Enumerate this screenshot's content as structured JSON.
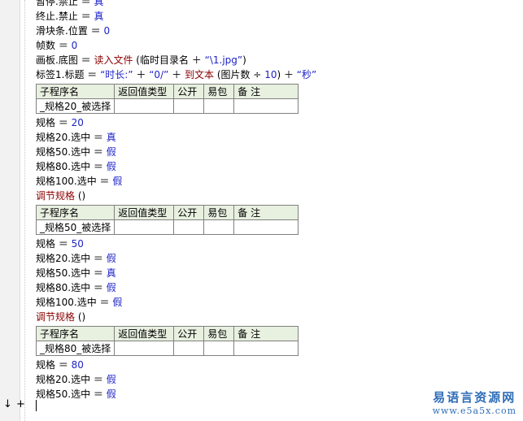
{
  "lines_top": [
    {
      "a": "暂停.禁止 ＝ ",
      "b": "真"
    },
    {
      "a": "终止.禁止 ＝ ",
      "b": "真"
    },
    {
      "a": "滑块条.位置 ＝ ",
      "b": "0"
    },
    {
      "a": "帧数 ＝ ",
      "b": "0"
    },
    {
      "a": "画板.底图 ＝ ",
      "fn": "读入文件",
      "c": " (临时目录名 ＋ ",
      "s": "“\\1.jpg”",
      "d": ")"
    },
    {
      "a": "标签1.标题 ＝ ",
      "s1": "“时长:”",
      "p1": " ＋ ",
      "s2": "“0/”",
      "p2": " ＋ ",
      "fn": "到文本",
      "c": " (图片数 ÷ ",
      "n": "10",
      "d": ") ＋ ",
      "s3": "“秒”"
    }
  ],
  "table_headers": [
    "子程序名",
    "返回值类型",
    "公开",
    "易包",
    "备 注"
  ],
  "blocks": [
    {
      "sub_name": "_规格20_被选择",
      "assign": {
        "a": "规格 ＝ ",
        "b": "20"
      },
      "checks": [
        {
          "a": "规格20.选中 ＝ ",
          "b": "真"
        },
        {
          "a": "规格50.选中 ＝ ",
          "b": "假"
        },
        {
          "a": "规格80.选中 ＝ ",
          "b": "假"
        },
        {
          "a": "规格100.选中 ＝ ",
          "b": "假"
        }
      ],
      "call": "调节规格",
      "call_suffix": " ()"
    },
    {
      "sub_name": "_规格50_被选择",
      "assign": {
        "a": "规格 ＝ ",
        "b": "50"
      },
      "checks": [
        {
          "a": "规格20.选中 ＝ ",
          "b": "假"
        },
        {
          "a": "规格50.选中 ＝ ",
          "b": "真"
        },
        {
          "a": "规格80.选中 ＝ ",
          "b": "假"
        },
        {
          "a": "规格100.选中 ＝ ",
          "b": "假"
        }
      ],
      "call": "调节规格",
      "call_suffix": " ()"
    },
    {
      "sub_name": "_规格80_被选择",
      "assign": {
        "a": "规格 ＝ ",
        "b": "80"
      },
      "checks": [
        {
          "a": "规格20.选中 ＝ ",
          "b": "假"
        },
        {
          "a": "规格50.选中 ＝ ",
          "b": "假"
        }
      ]
    }
  ],
  "markers": {
    "arrow": "↓",
    "plus": "+"
  },
  "watermark": {
    "title": "易语言资源网",
    "url": "www.e5a5x.com"
  }
}
